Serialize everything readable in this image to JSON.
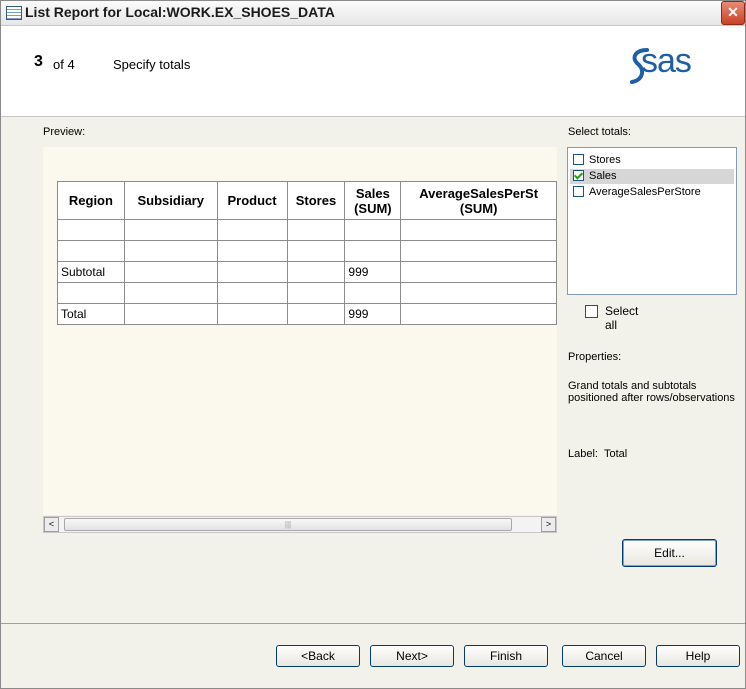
{
  "window": {
    "title": "List Report for Local:WORK.EX_SHOES_DATA",
    "close_glyph": "✕"
  },
  "header": {
    "step_number": "3",
    "step_of": "of 4",
    "step_title": "Specify totals",
    "logo_text": "sas",
    "logo_color": "#1f5fa5"
  },
  "preview": {
    "label": "Preview:",
    "columns": [
      {
        "line1": "Region",
        "line2": ""
      },
      {
        "line1": "Subsidiary",
        "line2": ""
      },
      {
        "line1": "Product",
        "line2": ""
      },
      {
        "line1": "Stores",
        "line2": ""
      },
      {
        "line1": "Sales",
        "line2": "(SUM)"
      },
      {
        "line1": "AverageSalesPerSt",
        "line2": "(SUM)"
      }
    ],
    "rows": [
      [
        "",
        "",
        "",
        "",
        "",
        ""
      ],
      [
        "",
        "",
        "",
        "",
        "",
        ""
      ],
      [
        "Subtotal",
        "",
        "",
        "",
        "999",
        ""
      ],
      [
        "",
        "",
        "",
        "",
        "",
        ""
      ],
      [
        "Total",
        "",
        "",
        "",
        "999",
        ""
      ]
    ],
    "scroll_left": "<",
    "scroll_right": ">",
    "scroll_grip": "|||"
  },
  "totals": {
    "label": "Select totals:",
    "items": [
      {
        "label": "Stores",
        "checked": false,
        "selected": false
      },
      {
        "label": "Sales",
        "checked": true,
        "selected": true
      },
      {
        "label": "AverageSalesPerStore",
        "checked": false,
        "selected": false
      }
    ],
    "select_all": "Select all"
  },
  "properties": {
    "label": "Properties:",
    "description": "Grand totals and subtotals positioned after rows/observations",
    "label_key": "Label:",
    "label_value": "Total"
  },
  "buttons": {
    "edit": "Edit...",
    "back": "<Back",
    "next": "Next>",
    "finish": "Finish",
    "cancel": "Cancel",
    "help": "Help"
  }
}
